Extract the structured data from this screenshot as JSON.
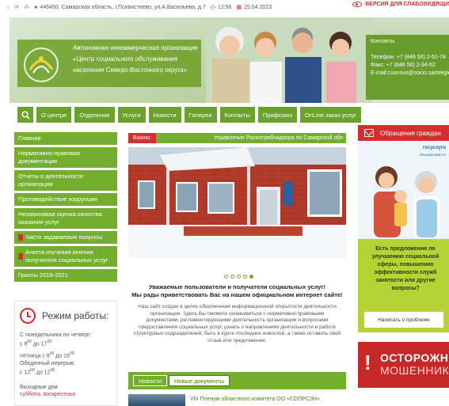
{
  "topbar": {
    "address": "446450, Самарская область, г.Похвистнево, ул.А.Васильева, д.7",
    "time": "12:56",
    "date": "25.04.2023",
    "vision_version": "ВЕРСИЯ ДЛЯ СЛАБОВИДЯЩИ"
  },
  "header": {
    "org_line1": "Автономная некоммерческая организация",
    "org_line2": "«Центр социального обслуживания",
    "org_line3": "населения Северо-Восточного округа»",
    "contacts_title": "Контакты",
    "phone": "Телефон: +7 (846 56) 2-51-74",
    "fax": "Факс: +7 (846 56) 2-34-52",
    "email": "E-mail:csonsvo@socio.samregio"
  },
  "nav": {
    "items": [
      "О центре",
      "Отделения",
      "Услуги",
      "Новости",
      "Галереи",
      "Контакты",
      "Профсоюз",
      "OnLine заказ услуг"
    ]
  },
  "sidebar": {
    "items": [
      {
        "label": "Главная"
      },
      {
        "label": "Нормативно-правовая документация"
      },
      {
        "label": "Отчеты о деятельности организации"
      },
      {
        "label": "Противодействие коррупции"
      },
      {
        "label": "Независимая оценка качества оказания услуг"
      },
      {
        "label": "Часто задаваемые вопросы"
      },
      {
        "label": "Анкета изучения мнения получателя социальных услуг"
      },
      {
        "label": "Гранты 2019-2021"
      }
    ]
  },
  "hours": {
    "title": "Режим работы:",
    "line1": "С понедельника по четверг:",
    "line2a": "с 8",
    "line2b": "00",
    "line2c": " до 17",
    "line2d": "00",
    "line3": "пятница с 8",
    "line3b": "00",
    "line3c": " до 16",
    "line3d": "00",
    "line4": "Обеденный перерыв:",
    "line5a": "с 12",
    "line5b": "00",
    "line5c": " до 12",
    "line5d": "48",
    "days_off": "Выходные дни:",
    "days_off_value": "суббота, воскресенье"
  },
  "important": {
    "label": "Важно:",
    "ticker": "Управление Роспотребнадзора по Самарской обл"
  },
  "slider": {
    "count": 5,
    "active": 4
  },
  "welcome": {
    "heading1": "Уважаемые пользователи и получатели социальных услуг!",
    "heading2": "Мы рады приветствовать Вас на нашем официальном интернет сайте!",
    "body": "Наш сайт создан в целях обеспечения информационной открытости деятельности организации. Здесь Вы сможете ознакомиться с нормативно-правовыми документами, регламентирующими деятельность организации и вопросами предоставления социальных услуг, узнать о направлениях деятельности и работе структурных подразделений, быть в курсе последних новостей, а также оставить свой отзыв или предложение."
  },
  "tabs": {
    "news": "Новости",
    "docs": "Новые документы"
  },
  "news": {
    "first": "VIII Пленум областного комитета ОО «СОПРСЗН»."
  },
  "right": {
    "appeal": "Обращения граждан",
    "gos_brand": "госуслуги",
    "gos_sub": "Решаем вместе",
    "gos_text": "Есть предложения по улучшению социальной сферы, повышению эффективности служб занятости или другие вопросы?",
    "gos_button": "Написать о проблеме",
    "fraud1": "ОСТОРОЖНО",
    "fraud2": "МОШЕННИКИ"
  }
}
